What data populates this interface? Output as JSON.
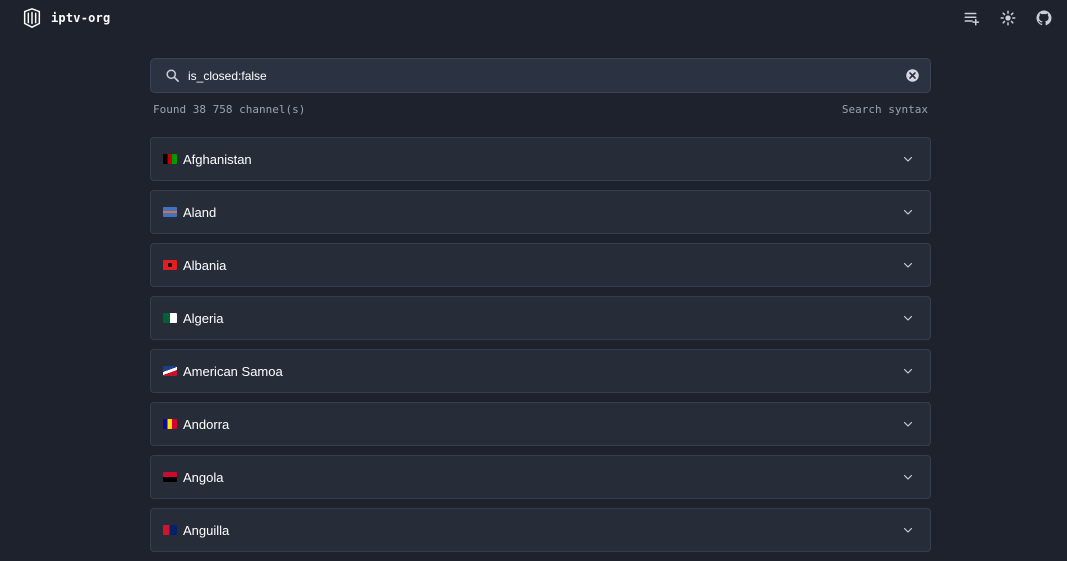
{
  "header": {
    "brand": "iptv-org",
    "actions": [
      "playlist-add-icon",
      "sun-icon",
      "github-icon"
    ]
  },
  "search": {
    "value": "is_closed:false",
    "placeholder": "Search"
  },
  "results": {
    "found_text": "Found 38 758 channel(s)",
    "syntax_link": "Search syntax"
  },
  "countries": [
    {
      "name": "Afghanistan",
      "flag": "flag-af-icon"
    },
    {
      "name": "Aland",
      "flag": "flag-ax-icon"
    },
    {
      "name": "Albania",
      "flag": "flag-al-icon"
    },
    {
      "name": "Algeria",
      "flag": "flag-dz-icon"
    },
    {
      "name": "American Samoa",
      "flag": "flag-as-icon"
    },
    {
      "name": "Andorra",
      "flag": "flag-ad-icon"
    },
    {
      "name": "Angola",
      "flag": "flag-ao-icon"
    },
    {
      "name": "Anguilla",
      "flag": "flag-ai-icon"
    }
  ],
  "colors": {
    "background": "#1e222d",
    "card": "#272c39",
    "input": "#2b3342",
    "muted_text": "#9aa3b2"
  }
}
